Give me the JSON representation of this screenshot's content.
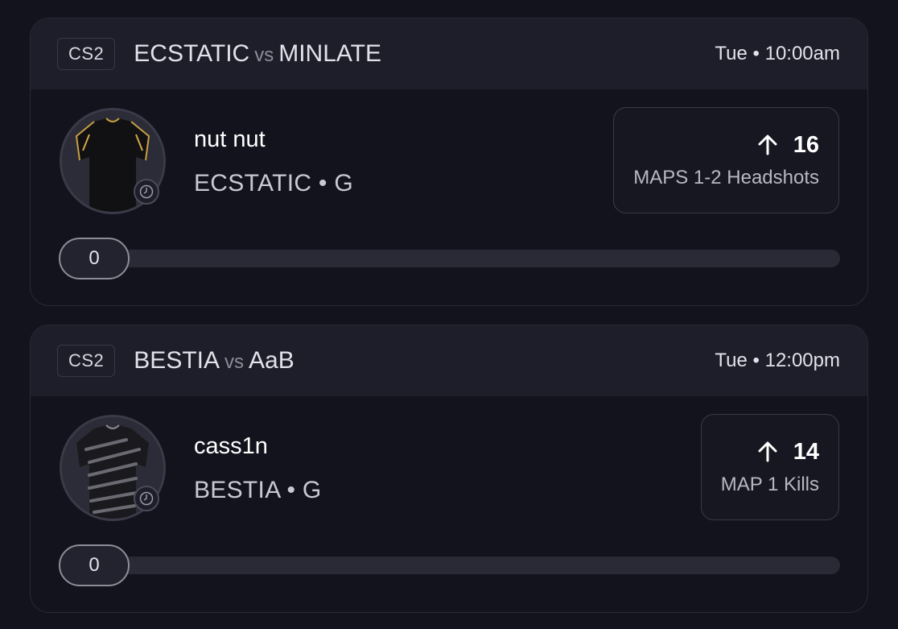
{
  "cards": [
    {
      "game": "CS2",
      "team_a": "ECSTATIC",
      "vs": "vs",
      "team_b": "MINLATE",
      "time": "Tue • 10:00am",
      "player": {
        "name": "nut nut",
        "team_line": "ECSTATIC • G",
        "avatar_icon": "black-jersey-gold-trim-icon"
      },
      "stat": {
        "direction_icon": "arrow-up-icon",
        "value": "16",
        "label": "MAPS 1-2 Headshots"
      },
      "progress": {
        "value": "0",
        "fraction": 0
      }
    },
    {
      "game": "CS2",
      "team_a": "BESTIA",
      "vs": "vs",
      "team_b": "AaB",
      "time": "Tue • 12:00pm",
      "player": {
        "name": "cass1n",
        "team_line": "BESTIA • G",
        "avatar_icon": "black-striped-jersey-icon"
      },
      "stat": {
        "direction_icon": "arrow-up-icon",
        "value": "14",
        "label": "MAP 1 Kills"
      },
      "progress": {
        "value": "0",
        "fraction": 0
      }
    }
  ],
  "colors": {
    "background": "#13131d",
    "header": "#1e1e2a",
    "border": "#2a2a37",
    "track": "#2a2a36"
  }
}
